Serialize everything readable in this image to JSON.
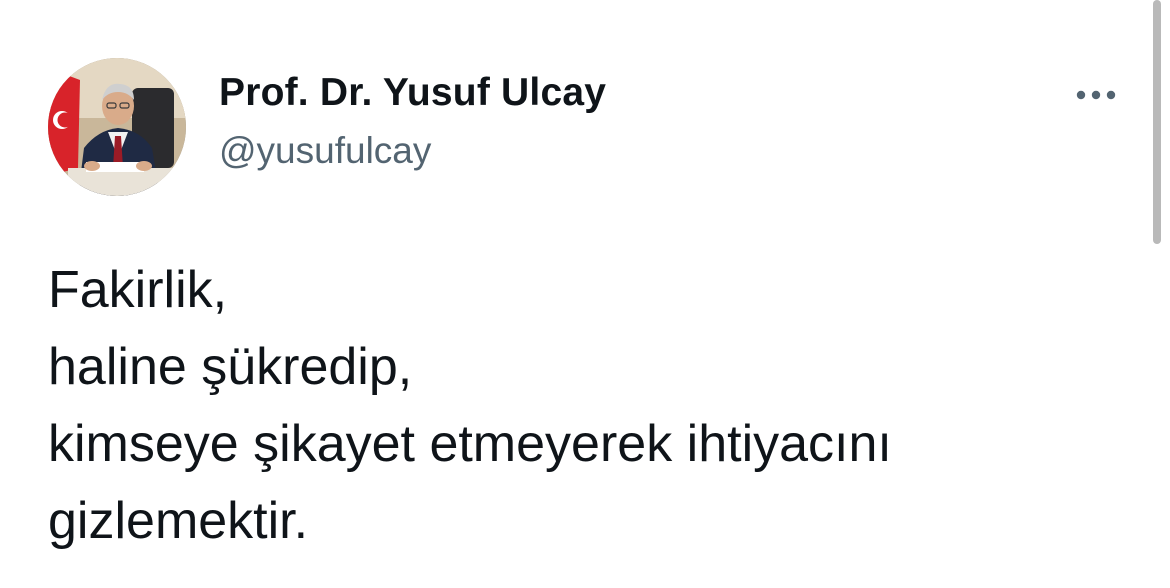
{
  "tweet": {
    "author": {
      "display_name": "Prof. Dr. Yusuf Ulcay",
      "handle": "@yusufulcay"
    },
    "text_lines": [
      "Fakirlik,",
      "haline şükredip,",
      "kimseye şikayet etmeyerek ihtiyacını",
      "gizlemektir."
    ],
    "more_icon": "more-horizontal-icon",
    "colors": {
      "primary_text": "#0f1419",
      "secondary_text": "#536471",
      "background": "#ffffff"
    }
  }
}
